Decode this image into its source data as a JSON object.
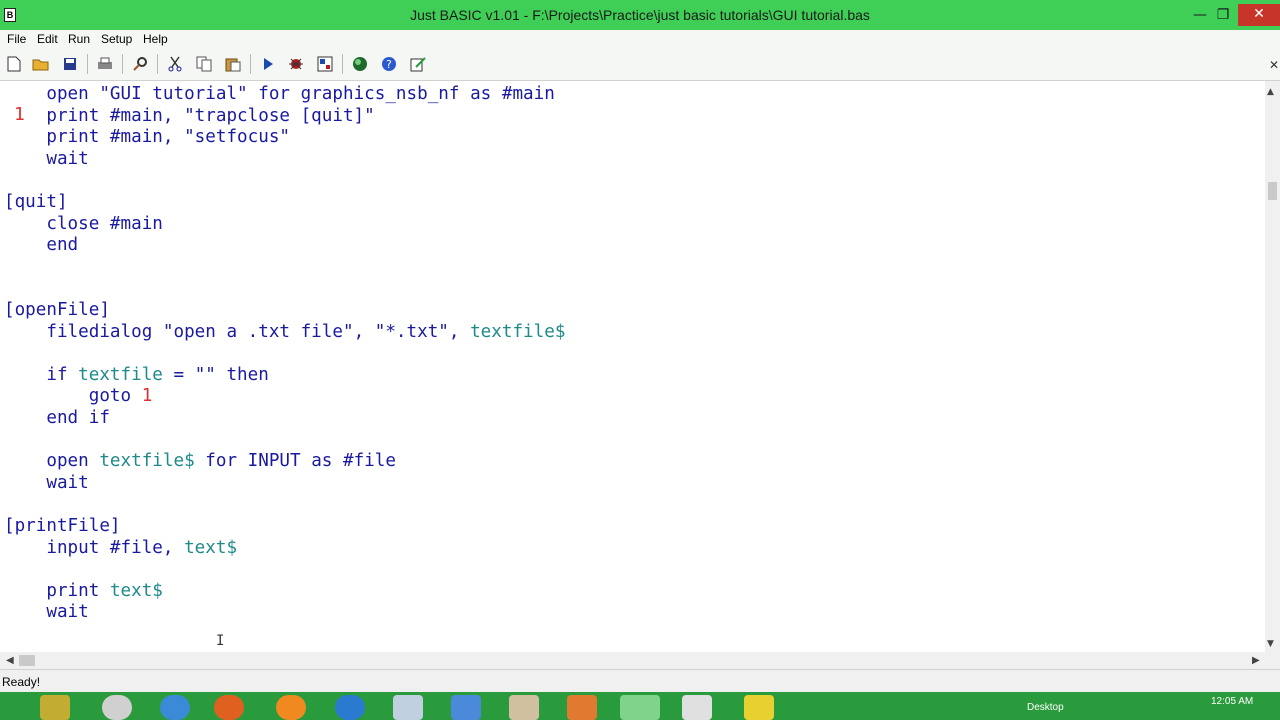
{
  "window": {
    "title": "Just BASIC v1.01 - F:\\Projects\\Practice\\just basic tutorials\\GUI tutorial.bas",
    "app_icon_letter": "B",
    "controls": {
      "minimize": "—",
      "maximize": "❐",
      "close": "✕"
    }
  },
  "menu": [
    "File",
    "Edit",
    "Run",
    "Setup",
    "Help"
  ],
  "toolbar": [
    "new-file-icon",
    "open-folder-icon",
    "save-icon",
    "print-icon",
    "find-icon",
    "cut-icon",
    "copy-icon",
    "paste-icon",
    "run-icon",
    "debug-icon",
    "gui-editor-icon",
    "globe-icon",
    "help-icon",
    "notes-icon"
  ],
  "editor": {
    "gutter_marker": "1",
    "lines": [
      "    open \"GUI tutorial\" for graphics_nsb_nf as #main",
      "    print #main, \"trapclose [quit]\"",
      "    print #main, \"setfocus\"",
      "    wait",
      "",
      "[quit]",
      "    close #main",
      "    end",
      "",
      "",
      "[openFile]",
      "    filedialog \"open a .txt file\", \"*.txt\", textfile$",
      "",
      "    if textfile = \"\" then",
      "        goto 1",
      "    end if",
      "",
      "    open textfile$ for INPUT as #file",
      "    wait",
      "",
      "[printFile]",
      "    input #file, text$",
      "",
      "    print text$",
      "    wait"
    ]
  },
  "status": {
    "text": "Ready!"
  },
  "taskbar": {
    "desktop_label": "Desktop",
    "clock": "12:05 AM"
  },
  "colors": {
    "titlebar": "#3fcf56",
    "code_text": "#1a1aa0",
    "variable": "#1f8a8a",
    "number": "#e03030",
    "taskbar": "#2a9b3c"
  }
}
